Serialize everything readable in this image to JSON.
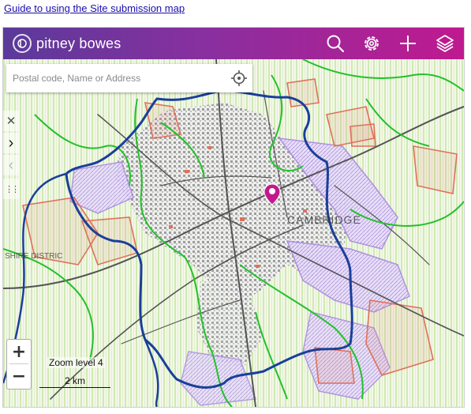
{
  "page": {
    "guide_link": "Guide to using the Site submission map"
  },
  "header": {
    "brand": "pitney bowes",
    "colors": {
      "gradient_start": "#5a3a9a",
      "gradient_end": "#c0198f"
    },
    "buttons": [
      {
        "name": "search",
        "icon": "search-icon"
      },
      {
        "name": "settings",
        "icon": "gear-icon"
      },
      {
        "name": "add",
        "icon": "plus-icon"
      },
      {
        "name": "layers",
        "icon": "layers-icon"
      }
    ]
  },
  "search": {
    "placeholder": "Postal code, Name or Address",
    "locate_icon": "crosshair-icon"
  },
  "side_tools": [
    {
      "icon": "close-icon",
      "glyph": "✕"
    },
    {
      "icon": "chevron-right-icon",
      "glyph": "›"
    },
    {
      "icon": "chevron-left-icon",
      "glyph": "‹"
    },
    {
      "icon": "drag-handle-icon",
      "glyph": "⋮⋮"
    }
  ],
  "map": {
    "labels": [
      "CAMBRIDGE",
      "SHIRE DISTRIC"
    ],
    "marker_color": "#c2188c",
    "colors": {
      "background": "#f5f7ec",
      "hatch": "#bfe59a",
      "road": "#555555",
      "boundary_blue": "#1a3f9a",
      "boundary_green": "#22c12a",
      "site_red": "#e0705a",
      "site_purple": "#a888e0"
    }
  },
  "controls": {
    "zoom_in": "+",
    "zoom_out": "−",
    "zoom_level": "Zoom level 4",
    "scale": "2 km"
  }
}
